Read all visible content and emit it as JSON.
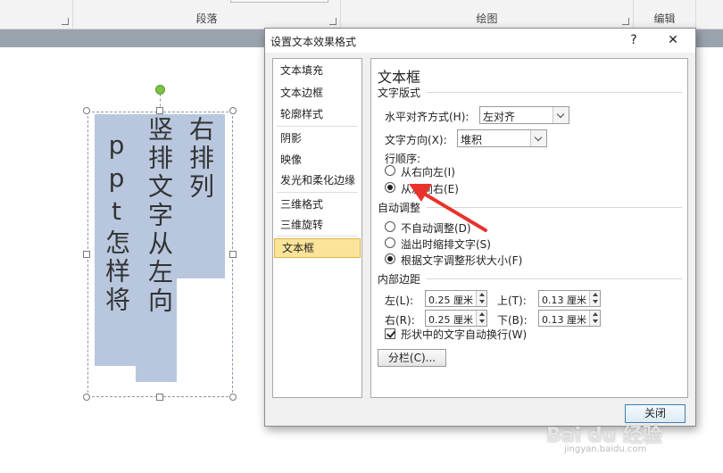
{
  "ribbon": {
    "groups": [
      {
        "label": "段落"
      },
      {
        "label": "绘图"
      },
      {
        "label": "编辑"
      }
    ]
  },
  "slide": {
    "columns": [
      {
        "text": "ppt怎样将"
      },
      {
        "text": "竖排文字从左向"
      },
      {
        "text": "右排列"
      }
    ]
  },
  "dialog": {
    "title": "设置文本效果格式",
    "help_glyph": "?",
    "close_glyph": "✕",
    "nav": [
      {
        "label": "文本填充"
      },
      {
        "label": "文本边框"
      },
      {
        "label": "轮廓样式"
      },
      {
        "label": "阴影"
      },
      {
        "label": "映像"
      },
      {
        "label": "发光和柔化边缘"
      },
      {
        "label": "三维格式"
      },
      {
        "label": "三维旋转"
      },
      {
        "label": "文本框"
      }
    ],
    "panel": {
      "title": "文本框",
      "text_layout": {
        "section": "文字版式",
        "halign_label": "水平对齐方式(H):",
        "halign_value": "左对齐",
        "direction_label": "文字方向(X):",
        "direction_value": "堆积",
        "order_label": "行顺序:",
        "order_rtl": "从右向左(I)",
        "order_ltr": "从左向右(E)"
      },
      "autofit": {
        "section": "自动调整",
        "opt1": "不自动调整(D)",
        "opt2": "溢出时缩排文字(S)",
        "opt3": "根据文字调整形状大小(F)"
      },
      "margins": {
        "section": "内部边距",
        "left_label": "左(L):",
        "left_value": "0.25 厘米",
        "right_label": "右(R):",
        "right_value": "0.25 厘米",
        "top_label": "上(T):",
        "top_value": "0.13 厘米",
        "bottom_label": "下(B):",
        "bottom_value": "0.13 厘米",
        "wrap_label": "形状中的文字自动换行(W)"
      },
      "columns_button": "分栏(C)..."
    },
    "close_button": "关闭"
  },
  "watermark": {
    "text": "Bai du 经验",
    "sub": "jingyan.baidu.com"
  },
  "colors": {
    "selection_fill": "#b8c7de",
    "nav_selected": "#fbe39a",
    "annotation_arrow": "#e8322b",
    "rotate_handle": "#7cc243"
  }
}
